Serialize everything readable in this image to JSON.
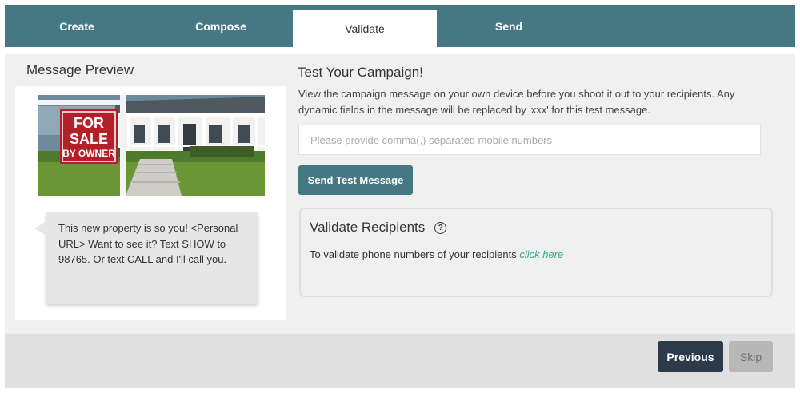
{
  "tabs": [
    {
      "label": "Create",
      "active": false
    },
    {
      "label": "Compose",
      "active": false
    },
    {
      "label": "Validate",
      "active": true
    },
    {
      "label": "Send",
      "active": false
    }
  ],
  "preview": {
    "title": "Message Preview",
    "image": {
      "sign_lines": [
        "FOR",
        "SALE",
        "BY OWNER"
      ]
    },
    "message": "This new property is so you! <Personal URL> Want to see it? Text SHOW to 98765. Or text CALL and I'll call you."
  },
  "test": {
    "title": "Test Your Campaign!",
    "description": "View the campaign message on your own device before you shoot it out to your recipients. Any dynamic fields in the message will be replaced by 'xxx' for this test message.",
    "phones_placeholder": "Please provide comma(,) separated mobile numbers",
    "phones_value": "",
    "send_button": "Send Test Message"
  },
  "validate": {
    "title": "Validate Recipients",
    "help_icon": "?",
    "text": "To validate phone numbers of your recipients",
    "link": "click here"
  },
  "footer": {
    "previous": "Previous",
    "skip": "Skip"
  },
  "colors": {
    "header": "#467883",
    "accent_button": "#467883",
    "previous_button": "#2c3a4a",
    "skip_button": "#b8b8b8",
    "link": "#3aa58f",
    "panel_bg": "#f0f0f0"
  }
}
